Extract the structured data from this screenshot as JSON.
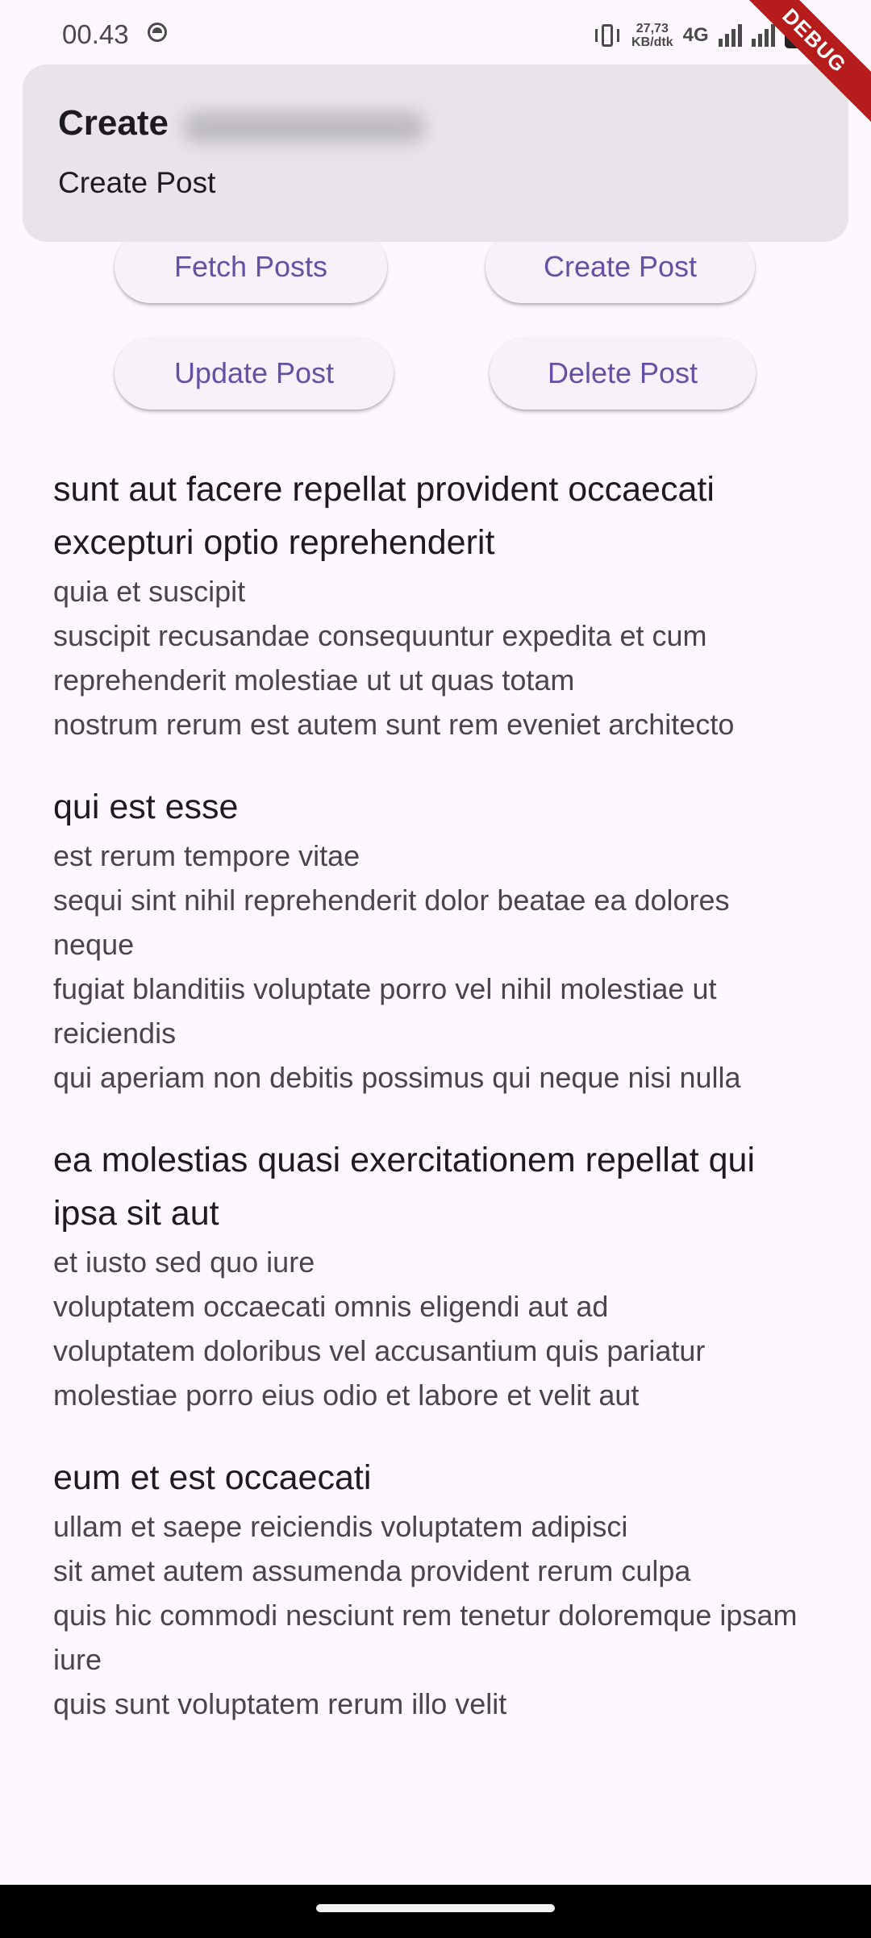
{
  "status_bar": {
    "time": "00.43",
    "net_speed_value": "27,73",
    "net_speed_unit": "KB/dtk",
    "network_type": "4G",
    "battery": "100"
  },
  "debug_banner": "DEBUG",
  "notification": {
    "title": "Create",
    "body": "Create Post"
  },
  "buttons": {
    "fetch": "Fetch Posts",
    "create": "Create Post",
    "update": "Update Post",
    "delete": "Delete Post"
  },
  "posts": [
    {
      "title": "sunt aut facere repellat provident occaecati excepturi optio reprehenderit",
      "body": "quia et suscipit\nsuscipit recusandae consequuntur expedita et cum reprehenderit molestiae ut ut quas totam\nnostrum rerum est autem sunt rem eveniet architecto"
    },
    {
      "title": "qui est esse",
      "body": "est rerum tempore vitae\nsequi sint nihil reprehenderit dolor beatae ea dolores neque\nfugiat blanditiis voluptate porro vel nihil molestiae ut reiciendis\nqui aperiam non debitis possimus qui neque nisi nulla"
    },
    {
      "title": "ea molestias quasi exercitationem repellat qui ipsa sit aut",
      "body": "et iusto sed quo iure\nvoluptatem occaecati omnis eligendi aut ad\nvoluptatem doloribus vel accusantium quis pariatur\nmolestiae porro eius odio et labore et velit aut"
    },
    {
      "title": "eum et est occaecati",
      "body": "ullam et saepe reiciendis voluptatem adipisci\nsit amet autem assumenda provident rerum culpa\nquis hic commodi nesciunt rem tenetur doloremque ipsam iure\nquis sunt voluptatem rerum illo velit"
    }
  ]
}
